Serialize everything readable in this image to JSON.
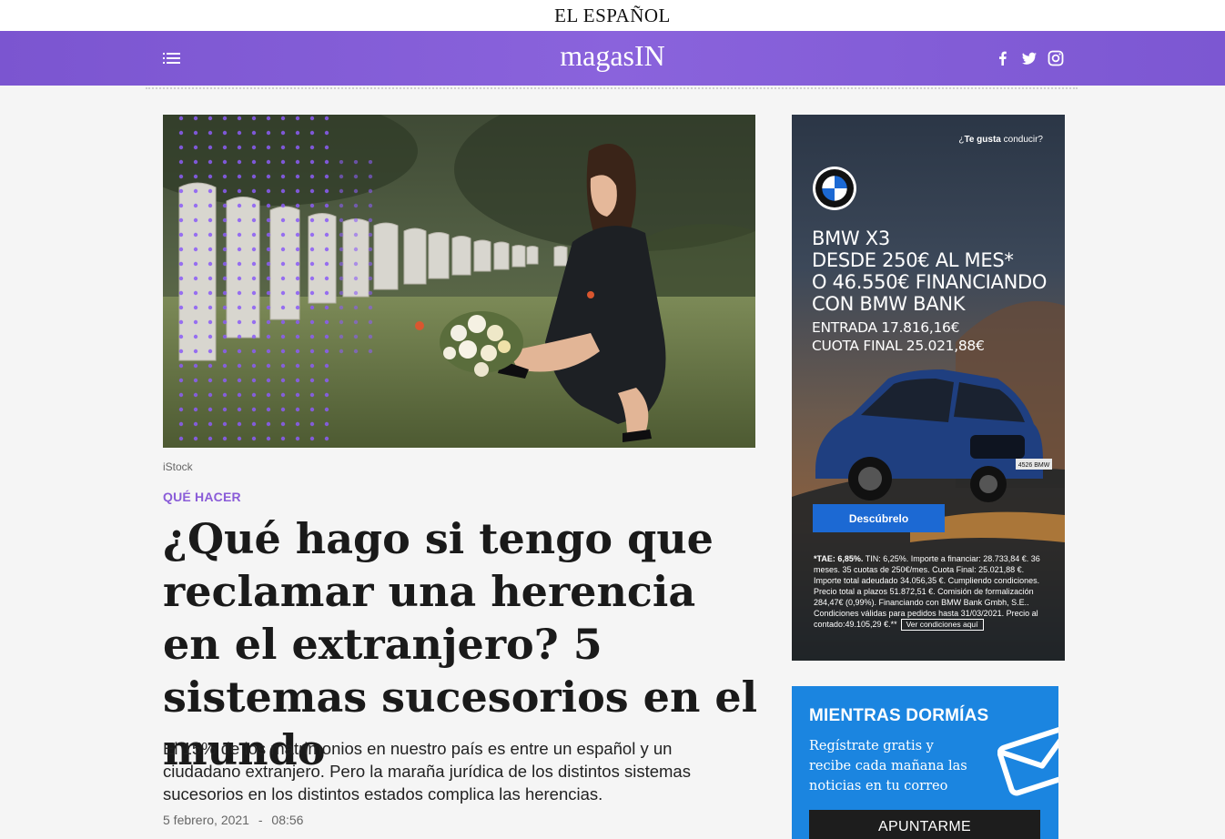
{
  "site": {
    "parent_logo_text": "EL ESPAÑOL",
    "brand_main": "magas",
    "brand_accent": "IN",
    "brand_color": "#8a63dc"
  },
  "header": {
    "menu_icon": "menu-icon",
    "social_icons": [
      "facebook-icon",
      "twitter-icon",
      "instagram-icon"
    ]
  },
  "article": {
    "image_credit": "iStock",
    "section": "QUÉ HACER",
    "title": "¿Qué hago si tengo que reclamar una herencia en el extranjero? 5 sistemas sucesorios en el mundo",
    "summary": "El 15% de los matrimonios en nuestro país es entre un español y un ciudadano extranjero. Pero la maraña jurídica de los distintos sistemas sucesorios en los distintos estados complica las herencias.",
    "date": "5 febrero, 2021",
    "separator": "-",
    "time": "08:56"
  },
  "ad": {
    "tag_prefix": "¿",
    "tag_bold": "Te gusta",
    "tag_rest": " conducir?",
    "title_lines": [
      "BMW X3",
      "DESDE 250€ AL MES*",
      "O 46.550€ FINANCIANDO",
      "CON BMW BANK"
    ],
    "sub_lines": [
      "ENTRADA 17.816,16€",
      "CUOTA FINAL 25.021,88€"
    ],
    "plate": "4526 BMW",
    "cta_label": "Descúbrelo",
    "legal_bold": "*TAE: 6,85%.",
    "legal_text": " TIN: 6,25%. Importe a financiar: 28.733,84 €. 36 meses. 35 cuotas de 250€/mes. Cuota Final: 25.021,88 €. Importe total adeudado 34.056,35 €. Cumpliendo condiciones. Precio total a plazos 51.872,51 €. Comisión de formalización 284,47€ (0,99%).  Financiando con BMW Bank Gmbh, S.E.. Condiciones válidas para pedidos hasta 31/03/2021. Precio al contado:49.105,29 €.**",
    "conditions_label": "Ver condiciones aquí"
  },
  "newsletter": {
    "title": "MIENTRAS DORMÍAS",
    "text": "Regístrate gratis y recibe cada mañana las noticias en tu correo",
    "button_label": "APUNTARME"
  }
}
